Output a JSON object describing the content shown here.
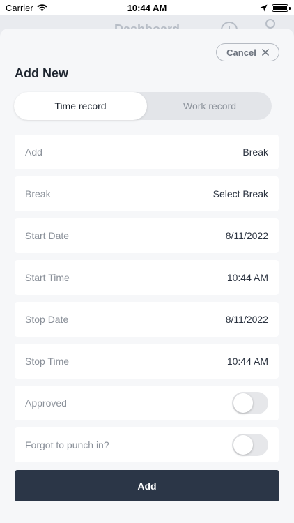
{
  "status_bar": {
    "carrier": "Carrier",
    "time": "10:44 AM"
  },
  "background": {
    "title": "Dashboard"
  },
  "sheet": {
    "cancel_label": "Cancel",
    "title": "Add New",
    "tabs": [
      {
        "label": "Time record",
        "active": true
      },
      {
        "label": "Work record",
        "active": false
      }
    ],
    "fields": [
      {
        "label": "Add",
        "value": "Break"
      },
      {
        "label": "Break",
        "value": "Select Break"
      },
      {
        "label": "Start Date",
        "value": "8/11/2022"
      },
      {
        "label": "Start Time",
        "value": "10:44 AM"
      },
      {
        "label": "Stop Date",
        "value": "8/11/2022"
      },
      {
        "label": "Stop Time",
        "value": "10:44 AM"
      }
    ],
    "toggles": [
      {
        "label": "Approved",
        "on": false
      },
      {
        "label": "Forgot to punch in?",
        "on": false
      }
    ],
    "submit_label": "Add"
  },
  "colors": {
    "primary_button": "#2b3647",
    "sheet_background": "#f6f7f9",
    "text_dark": "#1f2630",
    "text_muted": "#8a9099"
  }
}
